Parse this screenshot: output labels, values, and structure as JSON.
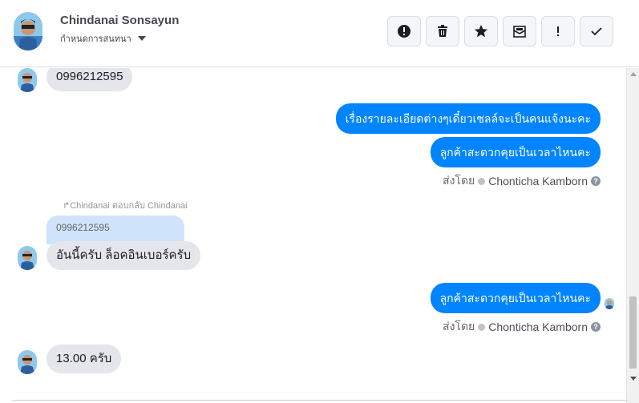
{
  "header": {
    "name": "Chindanai Sonsayun",
    "assign_label": "กำหนดการสนทนา",
    "actions": [
      {
        "name": "report-button",
        "icon": "alert-circle-icon"
      },
      {
        "name": "delete-button",
        "icon": "trash-icon"
      },
      {
        "name": "star-button",
        "icon": "star-icon"
      },
      {
        "name": "mark-unread-button",
        "icon": "envelope-icon"
      },
      {
        "name": "important-button",
        "icon": "exclamation-icon"
      },
      {
        "name": "done-button",
        "icon": "check-icon"
      }
    ]
  },
  "messages": {
    "m1": "0996212595",
    "m2": "เรื่องรายละเอียดต่างๆเดี๋ยวเซลล์จะเป็นคนแจ้งนะคะ",
    "m3": "ลูกค้าสะดวกคุยเป็นเวลาไหนคะ",
    "sent_by_prefix": "ส่งโดย",
    "sent_by_name": "Chonticha Kamborn",
    "reply_note": "Chindanai ตอบกลับ Chindanai",
    "reply_quote": "0996212595",
    "m4": "อันนี้ครับ ล็อคอินเบอร์ครับ",
    "m5": "ลูกค้าสะดวกคุยเป็นเวลาไหนคะ",
    "m6": "13.00 ครับ"
  },
  "colors": {
    "outgoing": "#0084ff",
    "incoming": "#e4e6eb",
    "reply": "#cfe3fb"
  }
}
